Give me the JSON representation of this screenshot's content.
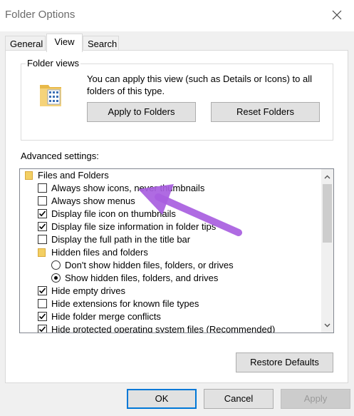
{
  "window": {
    "title": "Folder Options"
  },
  "tabs": [
    {
      "label": "General",
      "active": false
    },
    {
      "label": "View",
      "active": true
    },
    {
      "label": "Search",
      "active": false
    }
  ],
  "folder_views": {
    "label": "Folder views",
    "description": "You can apply this view (such as Details or Icons) to all folders of this type.",
    "apply_button": "Apply to Folders",
    "reset_button": "Reset Folders"
  },
  "advanced": {
    "label": "Advanced settings:",
    "items": [
      {
        "type": "folder",
        "label": "Files and Folders"
      },
      {
        "type": "checkbox",
        "label": "Always show icons, never thumbnails",
        "checked": false
      },
      {
        "type": "checkbox",
        "label": "Always show menus",
        "checked": false
      },
      {
        "type": "checkbox",
        "label": "Display file icon on thumbnails",
        "checked": true
      },
      {
        "type": "checkbox",
        "label": "Display file size information in folder tips",
        "checked": true
      },
      {
        "type": "checkbox",
        "label": "Display the full path in the title bar",
        "checked": false
      },
      {
        "type": "folder",
        "label": "Hidden files and folders"
      },
      {
        "type": "radio",
        "label": "Don't show hidden files, folders, or drives",
        "checked": false
      },
      {
        "type": "radio",
        "label": "Show hidden files, folders, and drives",
        "checked": true
      },
      {
        "type": "checkbox",
        "label": "Hide empty drives",
        "checked": true
      },
      {
        "type": "checkbox",
        "label": "Hide extensions for known file types",
        "checked": false
      },
      {
        "type": "checkbox",
        "label": "Hide folder merge conflicts",
        "checked": true
      },
      {
        "type": "checkbox",
        "label": "Hide protected operating system files (Recommended)",
        "checked": true
      }
    ]
  },
  "restore_defaults": "Restore Defaults",
  "footer": {
    "ok": "OK",
    "cancel": "Cancel",
    "apply": "Apply"
  },
  "colors": {
    "accent": "#0078d7",
    "annotation_arrow": "#a85ee0"
  }
}
